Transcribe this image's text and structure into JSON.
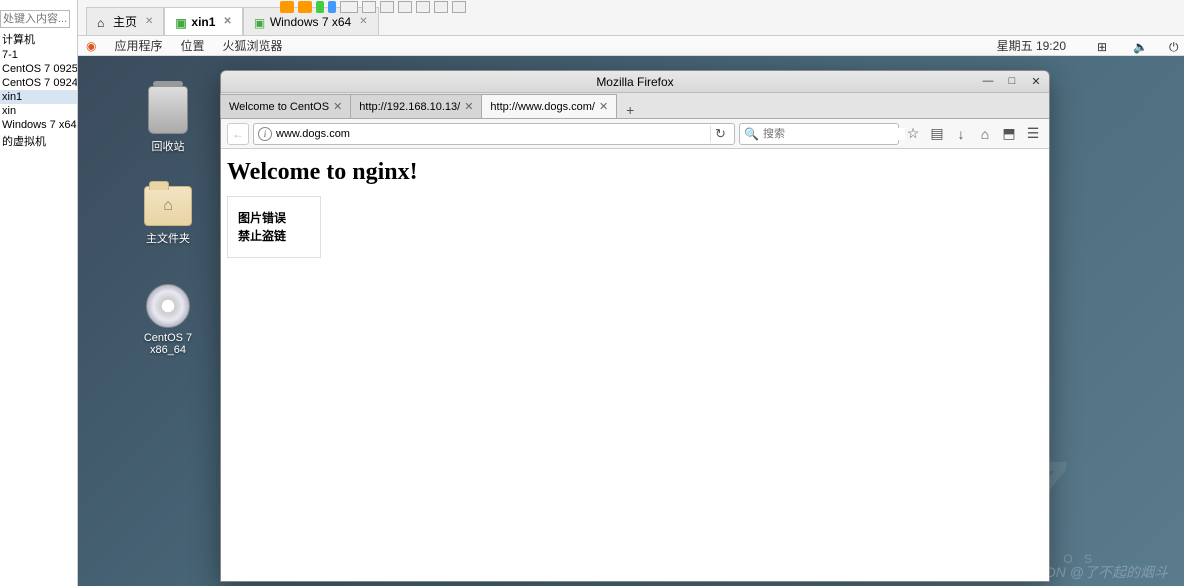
{
  "vm_sidebar": {
    "search_placeholder": "处键入内容...",
    "items": [
      "计算机",
      "7-1",
      "CentOS 7 0925",
      "CentOS 7 0924",
      "xin1",
      "xin",
      "Windows 7 x64",
      "的虚拟机"
    ],
    "selected_index": 4
  },
  "host_tabs": {
    "items": [
      {
        "label": "主页",
        "active": false
      },
      {
        "label": "xin1",
        "active": true
      },
      {
        "label": "Windows 7 x64",
        "active": false
      }
    ]
  },
  "menu_row": {
    "apps": "应用程序",
    "places": "位置",
    "browser": "火狐浏览器",
    "clock": "星期五 19:20"
  },
  "desktop_icons": {
    "trash": "回收站",
    "home": "主文件夹",
    "disc": "CentOS 7 x86_64"
  },
  "firefox": {
    "title": "Mozilla Firefox",
    "tabs": [
      {
        "label": "Welcome to CentOS",
        "active": false
      },
      {
        "label": "http://192.168.10.13/",
        "active": false
      },
      {
        "label": "http://www.dogs.com/",
        "active": true
      }
    ],
    "url": "www.dogs.com",
    "search_placeholder": "搜索",
    "page": {
      "heading": "Welcome to nginx!",
      "broken_img_line1": "图片错误",
      "broken_img_line2": "禁止盗链"
    }
  },
  "watermark": "CSDN @了不起的烟斗",
  "centos_wm": "O S"
}
